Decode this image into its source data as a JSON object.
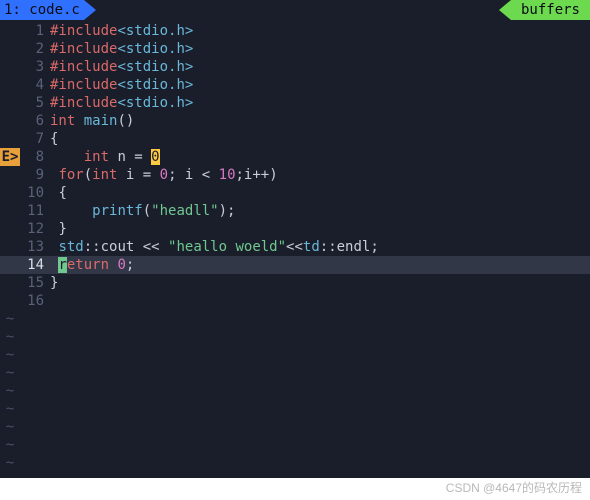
{
  "tab": {
    "left": "1: code.c",
    "right": "buffers"
  },
  "sign": {
    "error": "E>"
  },
  "lines": {
    "l1": {
      "num": "1",
      "pre": "#include",
      "tgt": "<stdio.h>"
    },
    "l2": {
      "num": "2",
      "pre": "#include",
      "tgt": "<stdio.h>"
    },
    "l3": {
      "num": "3",
      "pre": "#include",
      "tgt": "<stdio.h>"
    },
    "l4": {
      "num": "4",
      "pre": "#include",
      "tgt": "<stdio.h>"
    },
    "l5": {
      "num": "5",
      "pre": "#include",
      "tgt": "<stdio.h>"
    },
    "l6": {
      "num": "6",
      "type": "int",
      "fn": "main",
      "paren": "()"
    },
    "l7": {
      "num": "7",
      "brace": "{"
    },
    "l8": {
      "num": "8",
      "type": "int",
      "var": " n = ",
      "cur": "0"
    },
    "l9": {
      "num": "9",
      "for": "for",
      "p1": "(",
      "type": "int",
      "init": " i = ",
      "z": "0",
      "sep1": "; i < ",
      "ten": "10",
      "sep2": ";i++)"
    },
    "l10": {
      "num": "10",
      "brace": "{"
    },
    "l11": {
      "num": "11",
      "fn": "printf",
      "p1": "(",
      "str": "\"headll\"",
      "p2": ");"
    },
    "l12": {
      "num": "12",
      "brace": "}"
    },
    "l13": {
      "num": "13",
      "ns1": "std",
      "sc1": "::cout << ",
      "str": "\"heallo woeld\"",
      "op": "<<",
      "ns2": "td",
      "sc2": "::endl;"
    },
    "l14": {
      "num": "14",
      "r": "r",
      "rest": "eturn ",
      "z": "0",
      "semi": ";"
    },
    "l15": {
      "num": "15",
      "brace": "}"
    },
    "l16": {
      "num": "16"
    }
  },
  "tilde": "~",
  "watermark": "CSDN @4647的码农历程"
}
